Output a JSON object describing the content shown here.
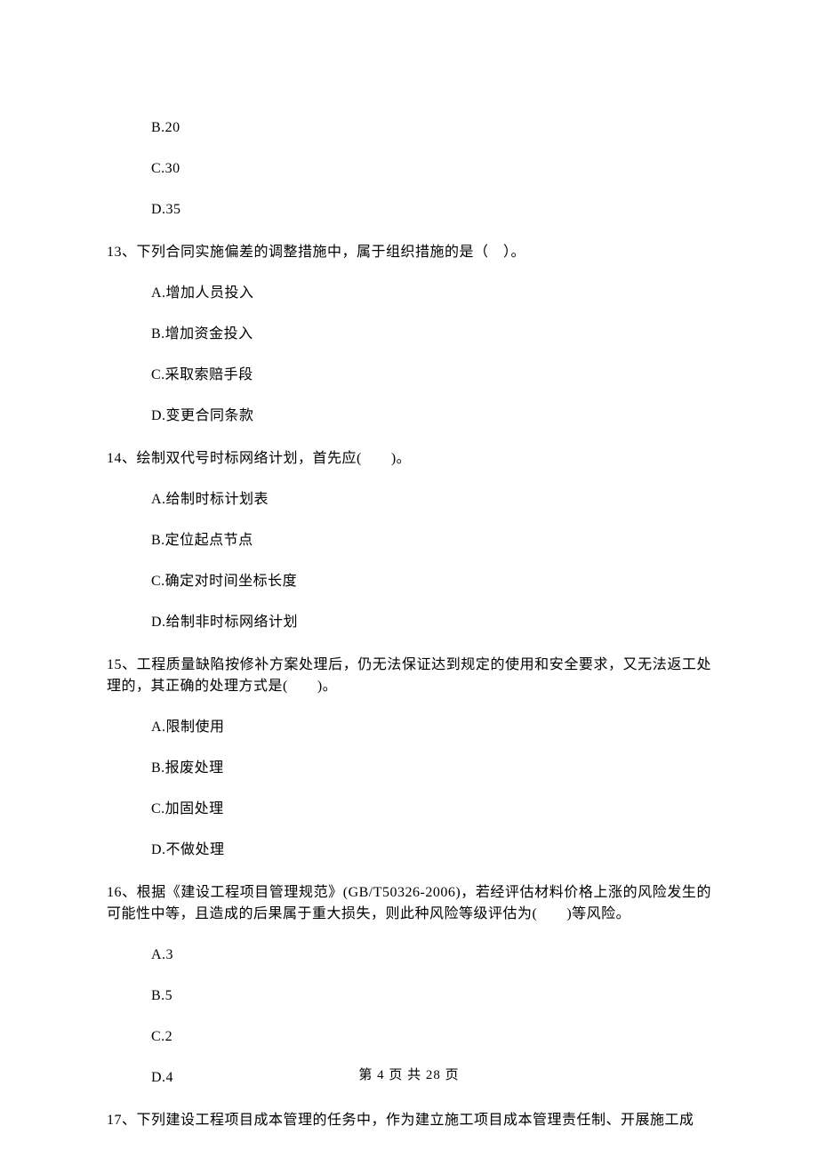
{
  "partial_options_top": [
    "B.20",
    "C.30",
    "D.35"
  ],
  "questions": [
    {
      "stem": "13、下列合同实施偏差的调整措施中，属于组织措施的是（　）。",
      "options": [
        "A.增加人员投入",
        "B.增加资金投入",
        "C.采取索赔手段",
        "D.变更合同条款"
      ]
    },
    {
      "stem": "14、绘制双代号时标网络计划，首先应(　　)。",
      "options": [
        "A.给制时标计划表",
        "B.定位起点节点",
        "C.确定对时间坐标长度",
        "D.给制非时标网络计划"
      ]
    },
    {
      "stem": "15、工程质量缺陷按修补方案处理后，仍无法保证达到规定的使用和安全要求，又无法返工处理的，其正确的处理方式是(　　)。",
      "options": [
        "A.限制使用",
        "B.报废处理",
        "C.加固处理",
        "D.不做处理"
      ]
    },
    {
      "stem": "16、根据《建设工程项目管理规范》(GB/T50326-2006)，若经评估材料价格上涨的风险发生的可能性中等，且造成的后果属于重大损失，则此种风险等级评估为(　　)等风险。",
      "options": [
        "A.3",
        "B.5",
        "C.2",
        "D.4"
      ]
    },
    {
      "stem": "17、下列建设工程项目成本管理的任务中，作为建立施工项目成本管理责任制、开展施工成",
      "options": []
    }
  ],
  "footer": "第 4 页 共 28 页"
}
